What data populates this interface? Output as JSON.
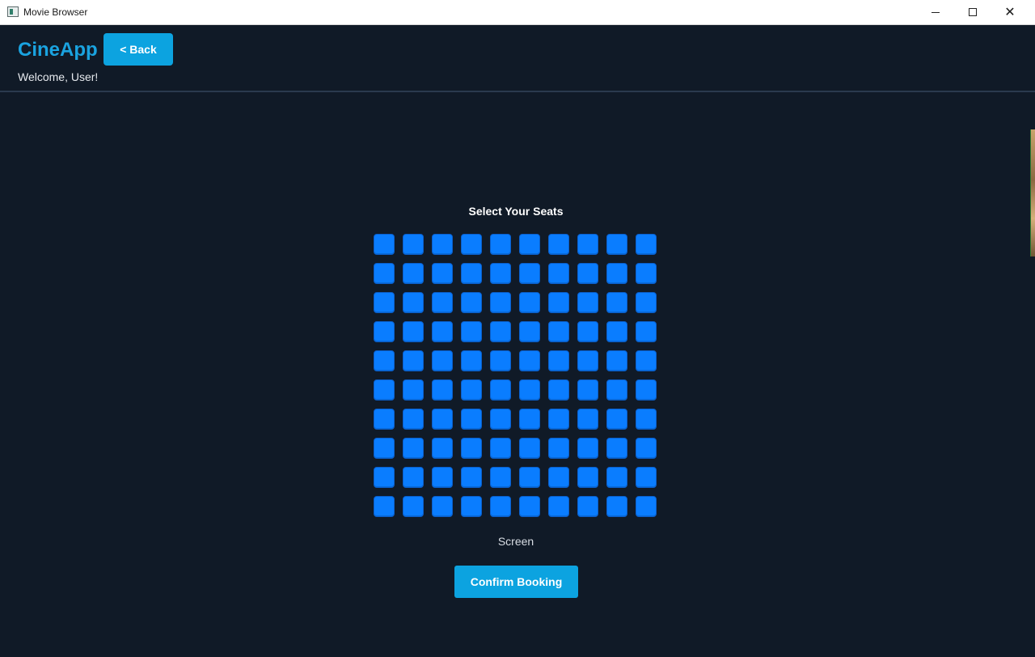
{
  "window": {
    "title": "Movie Browser",
    "controls": {
      "minimize": "minimize-icon",
      "maximize": "maximize-icon",
      "close": "close-icon"
    }
  },
  "header": {
    "logo": "CineApp",
    "back_label": "< Back",
    "welcome": "Welcome, User!"
  },
  "seat_selection": {
    "title": "Select Your Seats",
    "rows": 10,
    "columns": 10,
    "seat_color": "#0a7dff",
    "screen_label": "Screen",
    "confirm_label": "Confirm Booking"
  },
  "colors": {
    "accent": "#0ca3e0",
    "background": "#101a27",
    "seat_available": "#0a7dff"
  }
}
